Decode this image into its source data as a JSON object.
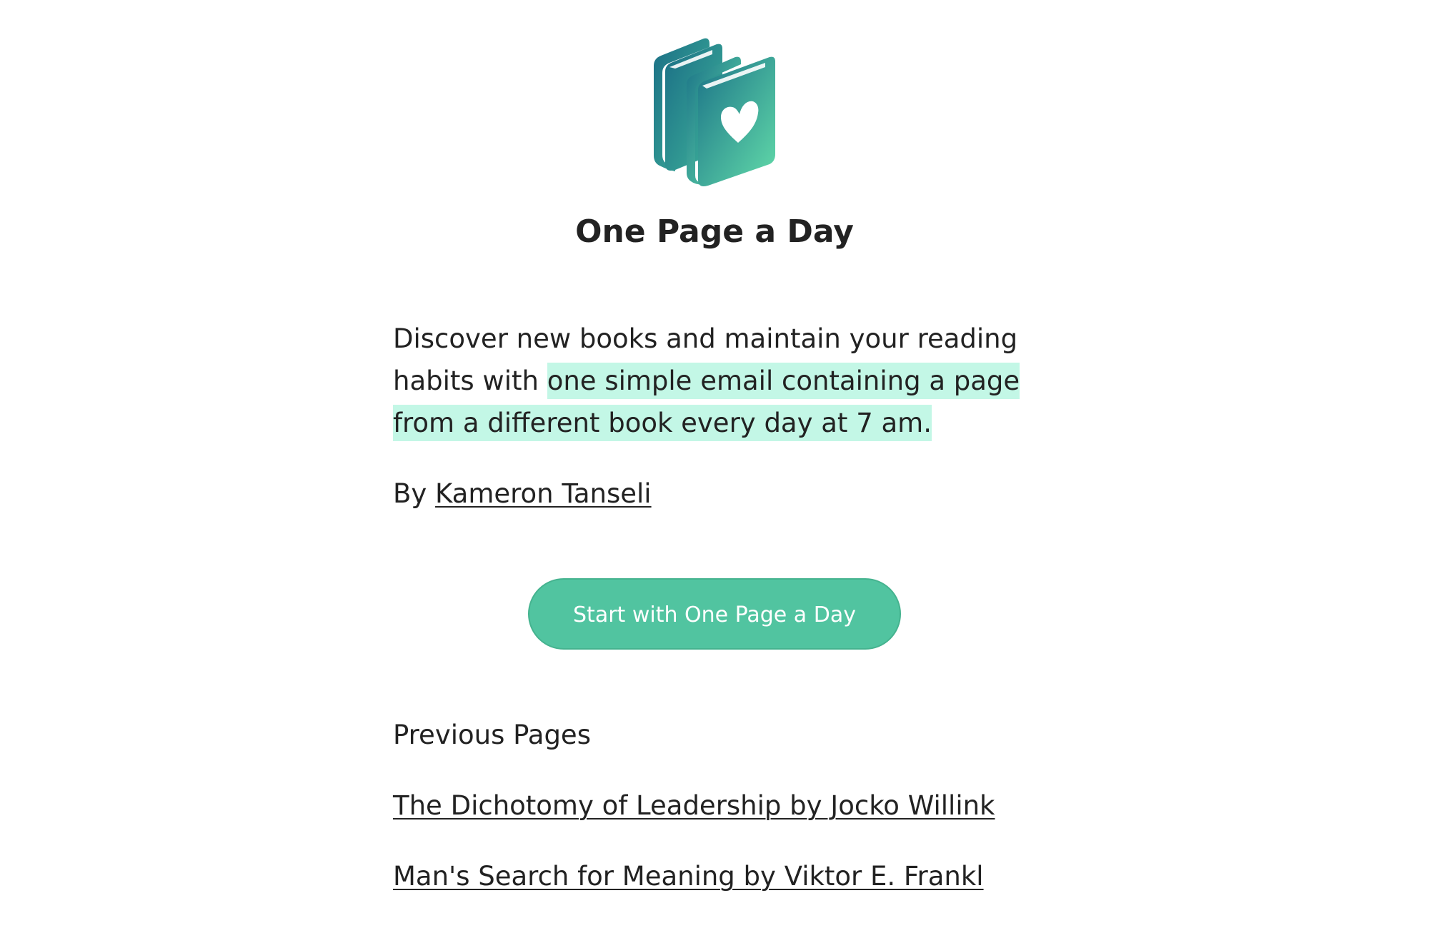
{
  "brand": {
    "title": "One Page a Day",
    "logo_icon": "books-heart-icon",
    "accent_color": "#51c4a0",
    "highlight_color": "#c3f7e6",
    "logo_gradient": [
      "#1b6f86",
      "#5fd6a6"
    ]
  },
  "intro": {
    "text_plain": "Discover new books and maintain your reading habits with ",
    "text_highlight": "one simple email containing a page from a different book every day at 7 am."
  },
  "byline": {
    "prefix": "By",
    "author_link": "Kameron Tanseli"
  },
  "cta": {
    "label": "Start with One Page a Day"
  },
  "previous": {
    "heading": "Previous Pages",
    "items": [
      {
        "label": "The Dichotomy of Leadership by Jocko Willink"
      },
      {
        "label": "Man's Search for Meaning by Viktor E. Frankl"
      }
    ]
  }
}
